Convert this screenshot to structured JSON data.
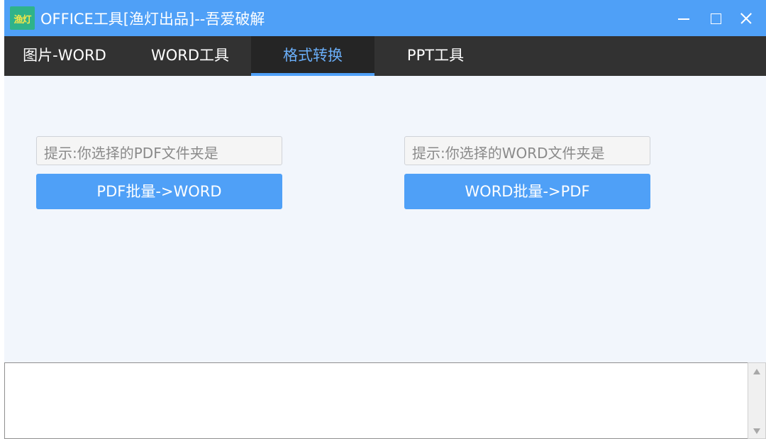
{
  "window": {
    "title": "OFFICE工具[渔灯出品]--吾爱破解",
    "logo_text": "渔灯",
    "controls": [
      "minimize-icon",
      "maximize-icon",
      "close-icon"
    ]
  },
  "tabs": [
    {
      "label": "图片-WORD",
      "active": false
    },
    {
      "label": "WORD工具",
      "active": false
    },
    {
      "label": "格式转换",
      "active": true
    },
    {
      "label": "PPT工具",
      "active": false
    }
  ],
  "pdf_panel": {
    "field_text": "提示:你选择的PDF文件夹是",
    "button_label": "PDF批量->WORD"
  },
  "word_panel": {
    "field_text": "提示:你选择的WORD文件夹是",
    "button_label": "WORD批量->PDF"
  },
  "log": {
    "content": ""
  },
  "colors": {
    "accent": "#4fa0f7",
    "tabbar_bg": "#323232",
    "content_bg": "#f2f6fc",
    "active_tab_text": "#6aaef8"
  }
}
